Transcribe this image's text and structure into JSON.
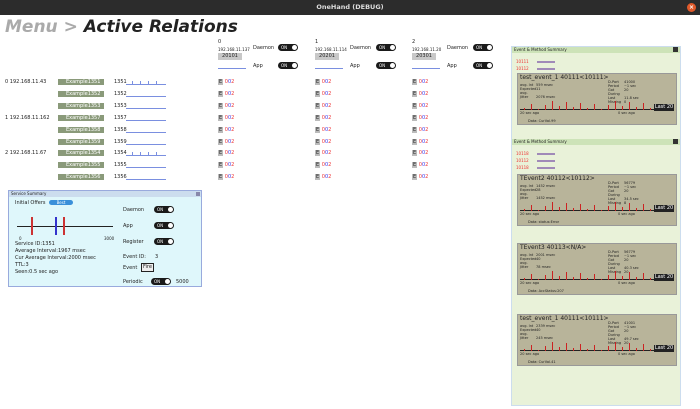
{
  "window": {
    "title": "OneHand (DEBUG)"
  },
  "breadcrumb": {
    "root": "Menu",
    "sep": ">",
    "current": "Active Relations"
  },
  "instances": [
    {
      "index": "0",
      "ip": "192.168.11.137",
      "id": "20101",
      "daemon": "Daemon",
      "app": "App",
      "toggle": "ON"
    },
    {
      "index": "1",
      "ip": "192.168.11.114",
      "id": "20201",
      "daemon": "Daemon",
      "app": "App",
      "toggle": "ON"
    },
    {
      "index": "2",
      "ip": "192.168.11.20",
      "id": "20301",
      "daemon": "Daemon",
      "app": "App",
      "toggle": "ON"
    }
  ],
  "hosts": [
    {
      "label": "0 192.168.11.43"
    },
    {
      "label": "1 192.168.11.162"
    },
    {
      "label": "2 192.168.11.67"
    }
  ],
  "rows": [
    {
      "name": "Example1351",
      "id": "1351"
    },
    {
      "name": "Example1352",
      "id": "1352"
    },
    {
      "name": "Example1353",
      "id": "1353"
    },
    {
      "name": "Example1357",
      "id": "1357"
    },
    {
      "name": "Example1358",
      "id": "1358"
    },
    {
      "name": "Example1359",
      "id": "1359"
    },
    {
      "name": "Example1354",
      "id": "1354"
    },
    {
      "name": "Example1355",
      "id": "1355"
    },
    {
      "name": "Example1356",
      "id": "1356"
    }
  ],
  "ecell": {
    "e": "E",
    "v0": "0",
    "v1": "0",
    "v2": "2"
  },
  "svc": {
    "header": "Service Summary",
    "initial": "Initial Offers",
    "pill": "Best",
    "slider_min": "0",
    "slider_max": "3000",
    "service_id": "Service ID:1351",
    "avg": "Average Interval:1967 msec",
    "cur": "Cur Average Interval:2000 msec",
    "ttl": "TTL:3",
    "seen": "Seen:0.5 sec ago",
    "daemon": "Daemon",
    "app": "App",
    "register": "Register",
    "event_id_label": "Event ID:",
    "event_id": "3",
    "event": "Event",
    "fire": "Fire",
    "periodic": "Periodic",
    "periodic_val": "5000",
    "on": "ON"
  },
  "em": {
    "header": "Event & Method Summary",
    "panel1": {
      "subs": [
        "10111",
        "10112"
      ],
      "ev": {
        "title": "test_event_1 40111<10111>",
        "stats": [
          "avg. Int",
          "559 msec",
          "Expected",
          "11",
          "avg. Jitter",
          "2076 msec"
        ],
        "right": [
          "D-Port",
          "41000",
          "Period",
          "~1 sec",
          "Got",
          "20",
          "During Last",
          "11.8 sec",
          "Missing",
          "0"
        ],
        "x0": "20 sec ago",
        "x1": "0 sec ago",
        "last": "Last 20",
        "data": "Data: CurVal.99"
      }
    },
    "panel2": {
      "subs": [
        "10118",
        "10112",
        "10118"
      ],
      "evs": [
        {
          "title": "TEvent2 40112<10112>",
          "stats": [
            "avg. Int",
            "1452 msec",
            "Expected",
            "28",
            "avg. Jitter",
            "1452 msec"
          ],
          "right": [
            "D-Port",
            "56779",
            "Period",
            "~1 sec",
            "Got",
            "20",
            "During Last",
            "34.5 sec",
            "Missing",
            "8"
          ],
          "x0": "20 sec ago",
          "x1": "0 sec ago",
          "last": "Last 20",
          "data": "Data: status:Error"
        },
        {
          "title": "TEvent3 40113<N/A>",
          "stats": [
            "avg. Int",
            "2001 msec",
            "Expected",
            "40",
            "avg. Jitter",
            "78 msec"
          ],
          "right": [
            "D-Port",
            "56779",
            "Period",
            "~1 sec",
            "Got",
            "20",
            "During Last",
            "40.3 sec",
            "Missing",
            "20"
          ],
          "x0": "20 sec ago",
          "x1": "0 sec ago",
          "last": "Last 20",
          "data": "Data: AccStatus:207"
        },
        {
          "title": "test_event_1 40111<10111>",
          "stats": [
            "avg. Int",
            "2339 msec",
            "Expected",
            "40",
            "avg. Jitter",
            "245 msec"
          ],
          "right": [
            "D-Port",
            "41001",
            "Period",
            "~1 sec",
            "Got",
            "20",
            "During Last",
            "49.7 sec",
            "Missing",
            "20"
          ],
          "x0": "20 sec ago",
          "x1": "0 sec ago",
          "last": "Last 20",
          "data": "Data: CurVal.41"
        }
      ]
    }
  }
}
